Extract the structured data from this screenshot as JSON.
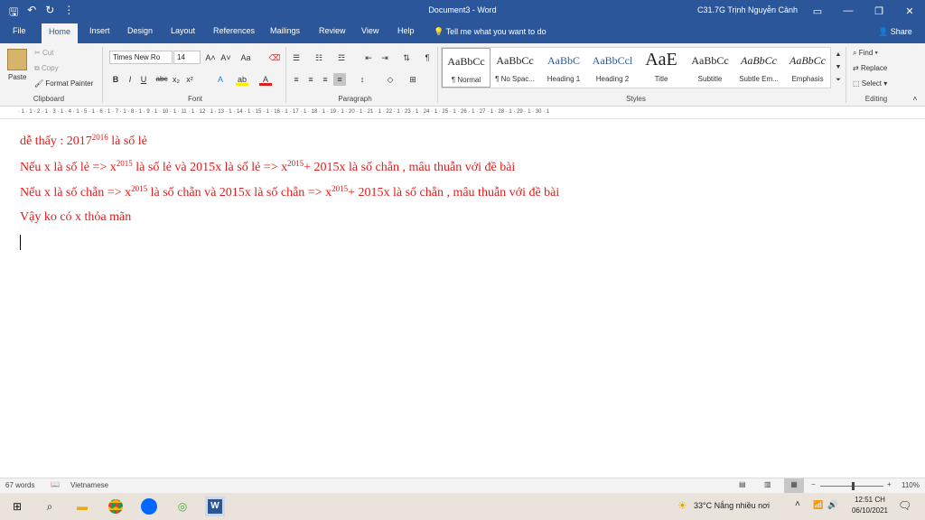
{
  "titlebar": {
    "doc_title": "Document3  -  Word",
    "user": "C31.7G Trịnh Nguyễn Cảnh",
    "qat": [
      "save-icon",
      "undo-icon",
      "redo-icon",
      "customize-icon"
    ],
    "qat_glyphs": [
      "🖫",
      "↶",
      "↻",
      "⋮"
    ],
    "win": [
      "ribbon-display-icon",
      "minimize-icon",
      "restore-icon",
      "close-icon"
    ],
    "win_glyphs": [
      "▭",
      "—",
      "❐",
      "✕"
    ]
  },
  "tabs": {
    "items": [
      "File",
      "Home",
      "Insert",
      "Design",
      "Layout",
      "References",
      "Mailings",
      "Review",
      "View",
      "Help"
    ],
    "active": "Home",
    "tell_me": "Tell me what you want to do",
    "share": "Share"
  },
  "clipboard": {
    "paste": "Paste",
    "cut": "Cut",
    "copy": "Copy",
    "format_painter": "Format Painter",
    "label": "Clipboard"
  },
  "font": {
    "name": "Times New Ro",
    "size": "14",
    "label": "Font"
  },
  "paragraph": {
    "label": "Paragraph"
  },
  "styles": {
    "label": "Styles",
    "items": [
      {
        "preview": "AaBbCc",
        "name": "¶ Normal"
      },
      {
        "preview": "AaBbCc",
        "name": "¶ No Spac..."
      },
      {
        "preview": "AaBbC",
        "name": "Heading 1"
      },
      {
        "preview": "AaBbCcl",
        "name": "Heading 2"
      },
      {
        "preview": "AaE",
        "name": "Title"
      },
      {
        "preview": "AaBbCc",
        "name": "Subtitle"
      },
      {
        "preview": "AaBbCc",
        "name": "Subtle Em..."
      },
      {
        "preview": "AaBbCc",
        "name": "Emphasis"
      }
    ],
    "accent": "#2b579a"
  },
  "editing": {
    "find": "Find",
    "replace": "Replace",
    "select": "Select",
    "label": "Editing"
  },
  "ruler": {
    "numbers": "· 1 · 1 · 2 · 1 · 3 · 1 · 4 · 1 · 5 · 1 · 6 · 1 · 7 · 1 · 8 · 1 · 9 · 1 · 10 · 1 · 11 · 1 · 12 · 1 · 13 · 1 · 14 · 1 · 15 · 1 · 16 · 1 · 17 · 1 · 18 · 1 · 19 · 1 · 20 · 1 · 21 · 1 · 22 · 1 · 23 · 1 · 24 · 1 · 25 · 1 · 26 · 1 · 27 · 1 · 28 · 1 · 29 · 1 · 30 · 1"
  },
  "document": {
    "color": "#e31b1b",
    "line1": {
      "a": "dễ thấy : 2017",
      "sup": "2016",
      "b": " là số lẻ"
    },
    "line2": {
      "a": "Nếu x là số lẻ =>   x",
      "sup1": "2015",
      "b": " là  số lẻ  và  2015x là số lẻ   => x",
      "sup2": "2015",
      "c": "+ 2015x    là số chẵn   , mâu thuẫn với đề bài"
    },
    "line3": {
      "a": "Nếu x là số chẵn =>   x",
      "sup1": "2015",
      "b": " là  số chẵn  và  2015x là số chẵn   => x",
      "sup2": "2015",
      "c": "+ 2015x    là số chẵn   , mâu thuẫn với đề bài"
    },
    "line4": "Vậy ko có x thỏa mãn"
  },
  "statusbar": {
    "words": "67 words",
    "language": "Vietnamese",
    "zoom": "110%"
  },
  "taskbar": {
    "weather": "33°C  Nắng nhiều nơi",
    "time": "12:51 CH",
    "date": "06/10/2021"
  }
}
